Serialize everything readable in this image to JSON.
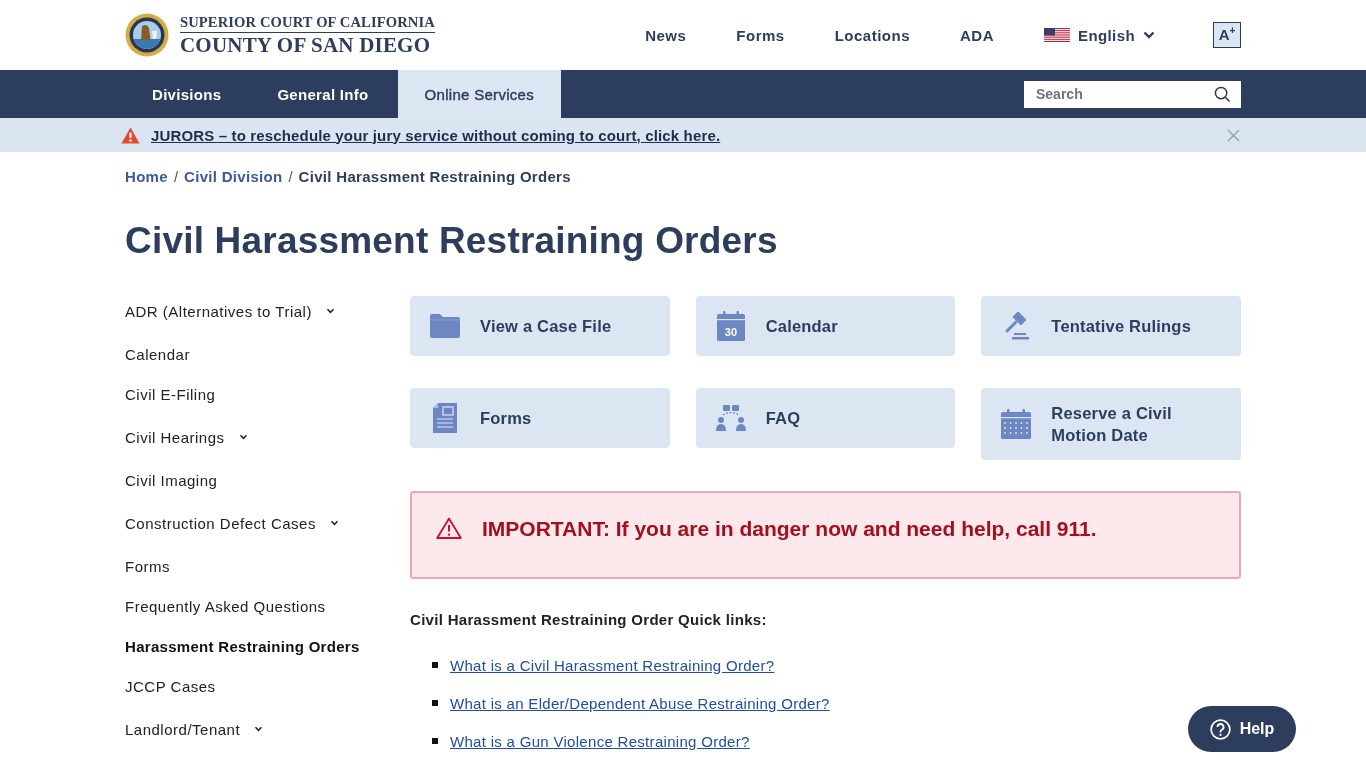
{
  "header": {
    "logo": {
      "line1": "SUPERIOR COURT OF CALIFORNIA",
      "line2": "COUNTY OF SAN DIEGO"
    },
    "links": [
      "News",
      "Forms",
      "Locations",
      "ADA"
    ],
    "language": {
      "label": "English"
    },
    "text_size_button": {
      "label": "A$^{+}$"
    }
  },
  "nav": {
    "tabs": [
      {
        "label": "Divisions",
        "selected": false
      },
      {
        "label": "General Info",
        "selected": false
      },
      {
        "label": "Online Services",
        "selected": true
      }
    ],
    "search": {
      "placeholder": "Search"
    }
  },
  "alert_strip": {
    "text": "JURORS – to reschedule your jury service without coming to court, click here."
  },
  "breadcrumb": [
    {
      "label": "Home",
      "current": false,
      "separator": "/"
    },
    {
      "label": "Civil Division",
      "current": false,
      "separator": "/"
    },
    {
      "label": "Civil Harassment Restraining Orders",
      "current": true
    }
  ],
  "page_title": "Civil Harassment Restraining Orders",
  "sidebar": {
    "items": [
      {
        "label": "ADR (Alternatives to Trial)",
        "has_submenu": true,
        "selected": false
      },
      {
        "label": "Calendar",
        "has_submenu": false,
        "selected": false
      },
      {
        "label": "Civil E-Filing",
        "has_submenu": false,
        "selected": false
      },
      {
        "label": "Civil Hearings",
        "has_submenu": true,
        "selected": false
      },
      {
        "label": "Civil Imaging",
        "has_submenu": false,
        "selected": false
      },
      {
        "label": "Construction Defect Cases",
        "has_submenu": true,
        "selected": false
      },
      {
        "label": "Forms",
        "has_submenu": false,
        "selected": false
      },
      {
        "label": "Frequently Asked Questions",
        "has_submenu": false,
        "selected": false
      },
      {
        "label": "Harassment Restraining Orders",
        "has_submenu": false,
        "selected": true
      },
      {
        "label": "JCCP Cases",
        "has_submenu": false,
        "selected": false
      },
      {
        "label": "Landlord/Tenant",
        "has_submenu": true,
        "selected": false
      }
    ]
  },
  "quick_cards": [
    {
      "label": "View a Case File"
    },
    {
      "label": "Calendar",
      "icon_number": "30"
    },
    {
      "label": "Tentative Rulings"
    },
    {
      "label": "Forms"
    },
    {
      "label": "FAQ"
    },
    {
      "label": "Reserve a Civil Motion Date"
    }
  ],
  "important_notice": {
    "text": "IMPORTANT: If you are in danger now and need help, call 911."
  },
  "quick_links": {
    "heading": "Civil Harassment Restraining Order Quick links:",
    "links": [
      "What is a Civil Harassment Restraining Order?",
      "What is an Elder/Dependent Abuse Restraining Order?",
      "What is a Gun Violence Restraining Order?"
    ]
  },
  "help_button": {
    "label": "Help"
  }
}
